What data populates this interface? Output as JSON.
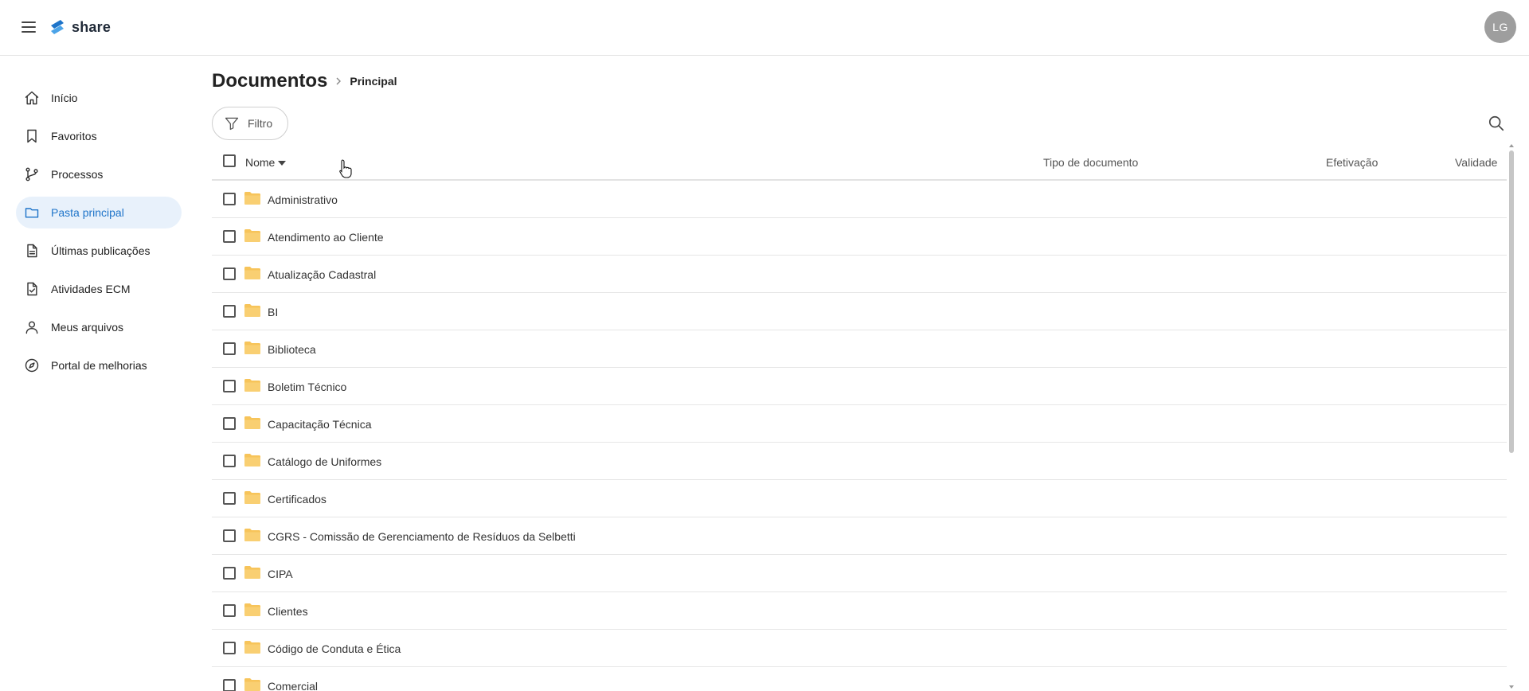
{
  "app": {
    "logo_text": "share",
    "avatar_initials": "LG"
  },
  "sidebar": {
    "items": [
      {
        "label": "Início",
        "icon": "home-icon",
        "active": false
      },
      {
        "label": "Favoritos",
        "icon": "bookmark-icon",
        "active": false
      },
      {
        "label": "Processos",
        "icon": "git-branch-icon",
        "active": false
      },
      {
        "label": "Pasta principal",
        "icon": "folder-icon",
        "active": true
      },
      {
        "label": "Últimas publicações",
        "icon": "document-icon",
        "active": false
      },
      {
        "label": "Atividades ECM",
        "icon": "document-check-icon",
        "active": false
      },
      {
        "label": "Meus arquivos",
        "icon": "user-icon",
        "active": false
      },
      {
        "label": "Portal de melhorias",
        "icon": "compass-icon",
        "active": false
      }
    ]
  },
  "breadcrumb": {
    "root": "Documentos",
    "current": "Principal"
  },
  "toolbar": {
    "filter_label": "Filtro"
  },
  "table": {
    "columns": {
      "name": "Nome",
      "type": "Tipo de documento",
      "effective": "Efetivação",
      "validity": "Validade"
    },
    "sort": {
      "column": "Nome",
      "direction": "desc"
    },
    "rows": [
      {
        "name": "Administrativo"
      },
      {
        "name": "Atendimento ao Cliente"
      },
      {
        "name": "Atualização Cadastral"
      },
      {
        "name": "BI"
      },
      {
        "name": "Biblioteca"
      },
      {
        "name": "Boletim Técnico"
      },
      {
        "name": "Capacitação Técnica"
      },
      {
        "name": "Catálogo de Uniformes"
      },
      {
        "name": "Certificados"
      },
      {
        "name": "CGRS - Comissão de Gerenciamento de Resíduos da Selbetti"
      },
      {
        "name": "CIPA"
      },
      {
        "name": "Clientes"
      },
      {
        "name": "Código de Conduta e Ética"
      },
      {
        "name": "Comercial"
      }
    ]
  },
  "colors": {
    "accent": "#1e74c9",
    "active_bg": "#e8f1fb",
    "folder": "#f7c45a"
  }
}
